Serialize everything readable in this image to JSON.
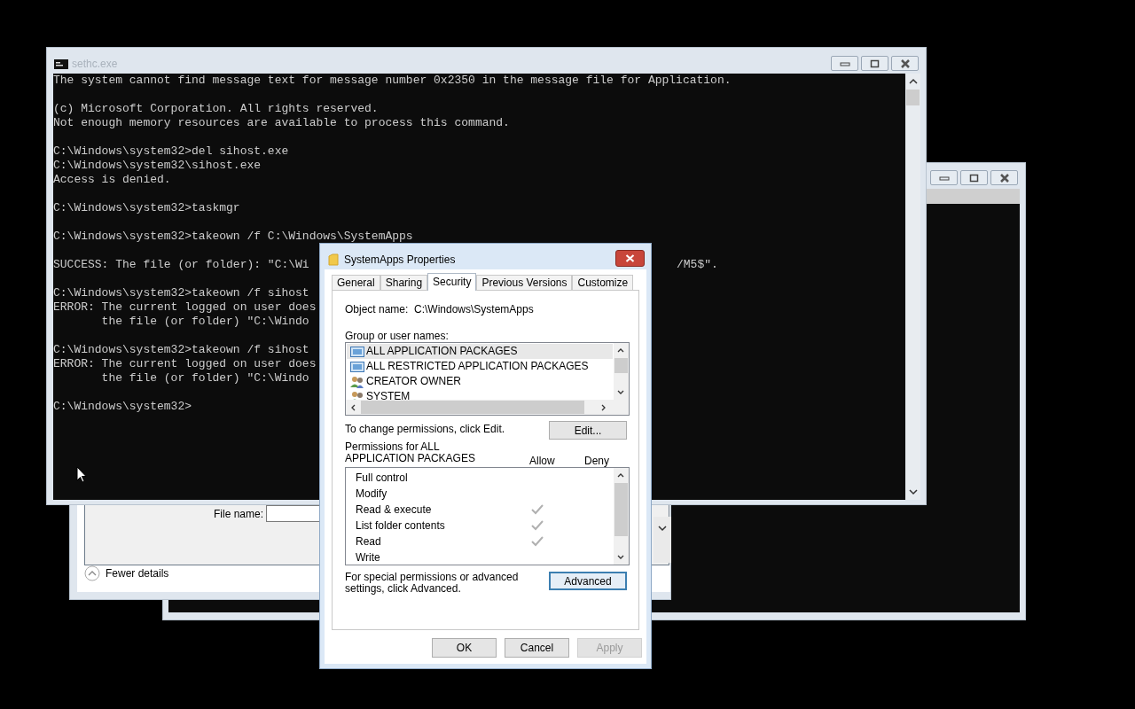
{
  "file_dialog": {
    "file_name_label": "File name:",
    "details_toggle": "Fewer details"
  },
  "console": {
    "title": "sethc.exe",
    "blocks": [
      [
        {
          "text": "The system cannot find message text for message number 0x2350 in the message file for Application."
        }
      ],
      [
        {
          "text": "(c) Microsoft Corporation. All rights reserved."
        },
        {
          "text": "Not enough memory resources are available to process this command."
        }
      ],
      [
        {
          "text": "C:\\Windows\\system32>del sihost.exe"
        },
        {
          "text": "C:\\Windows\\system32\\sihost.exe"
        },
        {
          "text": "Access is denied."
        }
      ],
      [
        {
          "text": "C:\\Windows\\system32>taskmgr"
        }
      ],
      [
        {
          "text": "C:\\Windows\\system32>takeown /f C:\\Windows\\SystemApps"
        }
      ],
      [
        {
          "text": "SUCCESS: The file (or folder): \"C:\\Wi",
          "tail": "/M5$\"."
        }
      ],
      [
        {
          "text": "C:\\Windows\\system32>takeown /f sihost"
        },
        {
          "text": "ERROR: The current logged on user does"
        },
        {
          "text": "       the file (or folder) \"C:\\Windo"
        }
      ],
      [
        {
          "text": "C:\\Windows\\system32>takeown /f sihost"
        },
        {
          "text": "ERROR: The current logged on user does"
        },
        {
          "text": "       the file (or folder) \"C:\\Windo"
        }
      ],
      [
        {
          "text": "C:\\Windows\\system32>"
        }
      ]
    ]
  },
  "dialog": {
    "title": "SystemApps Properties",
    "tabs": [
      {
        "label": "General",
        "selected": false
      },
      {
        "label": "Sharing",
        "selected": false
      },
      {
        "label": "Security",
        "selected": true
      },
      {
        "label": "Previous Versions",
        "selected": false
      },
      {
        "label": "Customize",
        "selected": false
      }
    ],
    "object_name_label": "Object name:",
    "object_name": "C:\\Windows\\SystemApps",
    "groups_label": "Group or user names:",
    "groups": [
      {
        "name": "ALL APPLICATION PACKAGES",
        "kind": "package",
        "selected": true
      },
      {
        "name": "ALL RESTRICTED APPLICATION PACKAGES",
        "kind": "package",
        "selected": false
      },
      {
        "name": "CREATOR OWNER",
        "kind": "users",
        "selected": false
      },
      {
        "name": "SYSTEM",
        "kind": "users",
        "selected": false
      }
    ],
    "change_hint": "To change permissions, click Edit.",
    "edit_button": "Edit...",
    "permissions_label": "Permissions for ALL APPLICATION PACKAGES",
    "allow_header": "Allow",
    "deny_header": "Deny",
    "permissions": [
      {
        "name": "Full control",
        "allow": false,
        "deny": false
      },
      {
        "name": "Modify",
        "allow": false,
        "deny": false
      },
      {
        "name": "Read & execute",
        "allow": true,
        "deny": false
      },
      {
        "name": "List folder contents",
        "allow": true,
        "deny": false
      },
      {
        "name": "Read",
        "allow": true,
        "deny": false
      },
      {
        "name": "Write",
        "allow": false,
        "deny": false
      }
    ],
    "advanced_hint": "For special permissions or advanced settings, click Advanced.",
    "advanced_button": "Advanced",
    "buttons": [
      {
        "label": "OK",
        "disabled": false
      },
      {
        "label": "Cancel",
        "disabled": false
      },
      {
        "label": "Apply",
        "disabled": true
      }
    ]
  }
}
